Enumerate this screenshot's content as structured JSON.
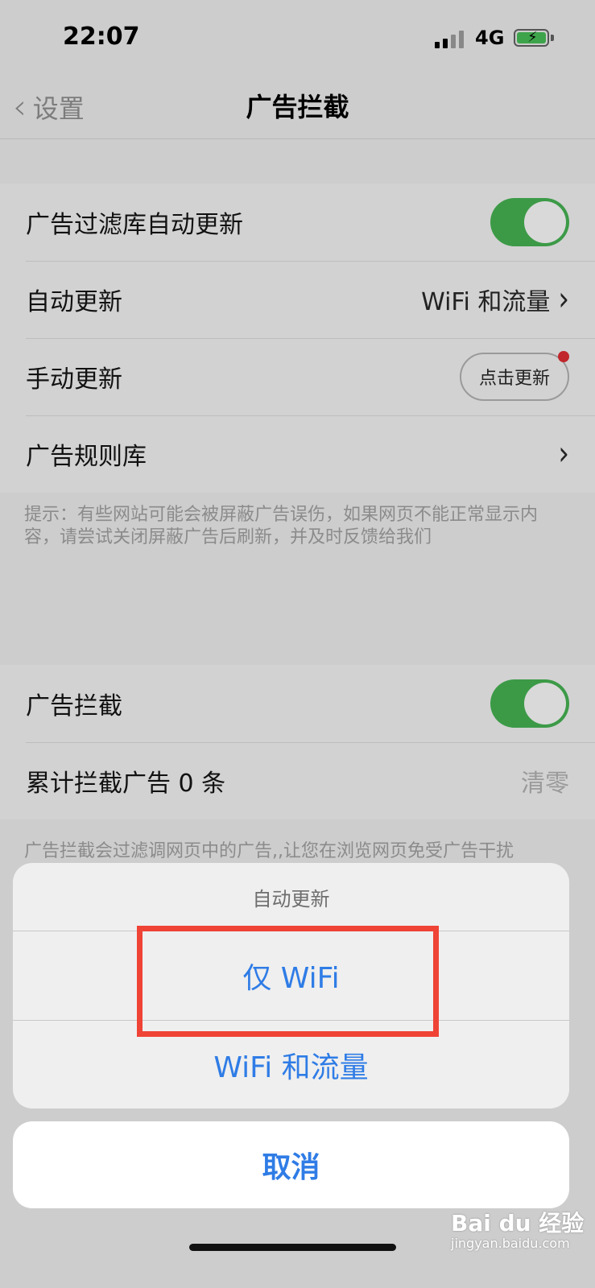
{
  "status_bar": {
    "time": "22:07",
    "network": "4G"
  },
  "nav": {
    "back_label": "设置",
    "title": "广告拦截"
  },
  "group1": {
    "auto_update_filter_label": "广告过滤库自动更新",
    "auto_update_label": "自动更新",
    "auto_update_value": "WiFi 和流量",
    "manual_update_label": "手动更新",
    "manual_update_button": "点击更新",
    "rules_label": "广告规则库"
  },
  "hint1": "提示：有些网站可能会被屏蔽广告误伤，如果网页不能正常显示内容，请尝试关闭屏蔽广告后刷新，并及时反馈给我们",
  "group2": {
    "adblock_label": "广告拦截",
    "blocked_count_label": "累计拦截广告 0 条",
    "clear_label": "清零"
  },
  "hint2": "广告拦截会过滤调网页中的广告,,让您在浏览网页免受广告干扰",
  "sheet": {
    "title": "自动更新",
    "option_wifi": "仅 WiFi",
    "option_wifi_data": "WiFi 和流量",
    "cancel": "取消"
  },
  "watermark": {
    "brand": "Bai du 经验",
    "url": "jingyan.baidu.com"
  },
  "colors": {
    "accent": "#2f7ce6",
    "toggle_on": "#3c9a47",
    "highlight": "#ef4336"
  }
}
